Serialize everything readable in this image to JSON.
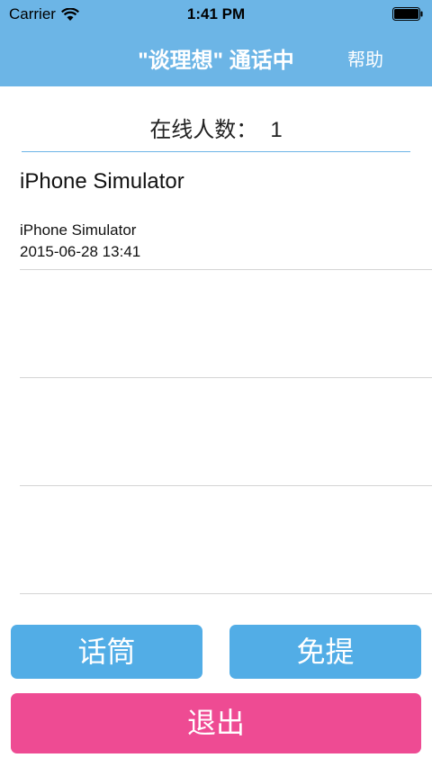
{
  "status_bar": {
    "carrier": "Carrier",
    "time": "1:41 PM",
    "icons": [
      "wifi-icon",
      "battery-icon"
    ]
  },
  "nav": {
    "title": "\"谈理想\" 通话中",
    "help_label": "帮助"
  },
  "online": {
    "label": "在线人数：",
    "count": "1"
  },
  "current_user": "iPhone Simulator",
  "list": {
    "items": [
      {
        "name": "iPhone Simulator",
        "time": "2015-06-28 13:41"
      },
      {
        "name": "",
        "time": ""
      },
      {
        "name": "",
        "time": ""
      },
      {
        "name": "",
        "time": ""
      }
    ]
  },
  "buttons": {
    "mic_label": "话筒",
    "speaker_label": "免提",
    "exit_label": "退出"
  },
  "colors": {
    "nav_bg": "#6cb5e6",
    "button_blue": "#52ade6",
    "button_pink": "#ee4b93"
  }
}
